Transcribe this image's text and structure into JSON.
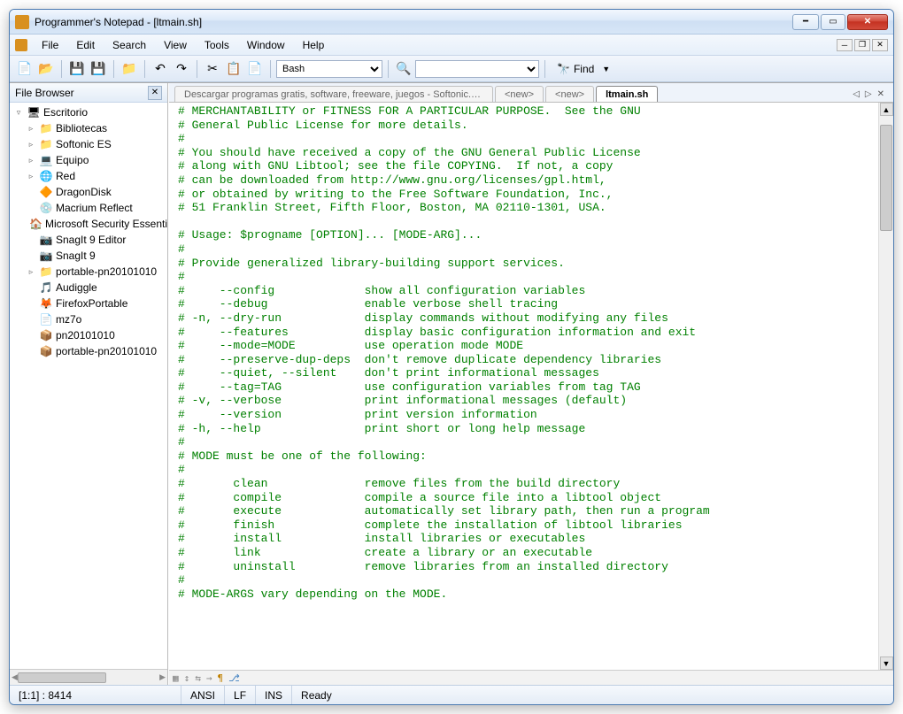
{
  "titlebar": {
    "title": "Programmer's Notepad - [ltmain.sh]"
  },
  "menubar": {
    "items": [
      "File",
      "Edit",
      "Search",
      "View",
      "Tools",
      "Window",
      "Help"
    ]
  },
  "toolbar": {
    "language_select": "Bash",
    "find_label": "Find"
  },
  "sidebar": {
    "title": "File Browser",
    "root": "Escritorio",
    "items": [
      {
        "label": "Bibliotecas",
        "expandable": true,
        "icon": "📁",
        "color": "#d8a038"
      },
      {
        "label": "Softonic ES",
        "expandable": true,
        "icon": "📁"
      },
      {
        "label": "Equipo",
        "expandable": true,
        "icon": "💻"
      },
      {
        "label": "Red",
        "expandable": true,
        "icon": "🌐"
      },
      {
        "label": "DragonDisk",
        "expandable": false,
        "icon": "🔶"
      },
      {
        "label": "Macrium Reflect",
        "expandable": false,
        "icon": "💿"
      },
      {
        "label": "Microsoft Security Essenti",
        "expandable": false,
        "icon": "🏠"
      },
      {
        "label": "SnagIt 9 Editor",
        "expandable": false,
        "icon": "📷"
      },
      {
        "label": "SnagIt 9",
        "expandable": false,
        "icon": "📷"
      },
      {
        "label": "portable-pn20101010",
        "expandable": true,
        "icon": "📁"
      },
      {
        "label": "Audiggle",
        "expandable": false,
        "icon": "🎵"
      },
      {
        "label": "FirefoxPortable",
        "expandable": false,
        "icon": "🦊"
      },
      {
        "label": "mz7o",
        "expandable": false,
        "icon": "📄"
      },
      {
        "label": "pn20101010",
        "expandable": false,
        "icon": "📦"
      },
      {
        "label": "portable-pn20101010",
        "expandable": false,
        "icon": "📦"
      }
    ]
  },
  "tabs": {
    "items": [
      {
        "label": "Descargar programas gratis, software, freeware, juegos - Softonic.htm",
        "active": false
      },
      {
        "label": "<new>",
        "active": false
      },
      {
        "label": "<new>",
        "active": false
      },
      {
        "label": "ltmain.sh",
        "active": true
      }
    ]
  },
  "code": {
    "lines": [
      "# MERCHANTABILITY or FITNESS FOR A PARTICULAR PURPOSE.  See the GNU",
      "# General Public License for more details.",
      "#",
      "# You should have received a copy of the GNU General Public License",
      "# along with GNU Libtool; see the file COPYING.  If not, a copy",
      "# can be downloaded from http://www.gnu.org/licenses/gpl.html,",
      "# or obtained by writing to the Free Software Foundation, Inc.,",
      "# 51 Franklin Street, Fifth Floor, Boston, MA 02110-1301, USA.",
      "",
      "# Usage: $progname [OPTION]... [MODE-ARG]...",
      "#",
      "# Provide generalized library-building support services.",
      "#",
      "#     --config             show all configuration variables",
      "#     --debug              enable verbose shell tracing",
      "# -n, --dry-run            display commands without modifying any files",
      "#     --features           display basic configuration information and exit",
      "#     --mode=MODE          use operation mode MODE",
      "#     --preserve-dup-deps  don't remove duplicate dependency libraries",
      "#     --quiet, --silent    don't print informational messages",
      "#     --tag=TAG            use configuration variables from tag TAG",
      "# -v, --verbose            print informational messages (default)",
      "#     --version            print version information",
      "# -h, --help               print short or long help message",
      "#",
      "# MODE must be one of the following:",
      "#",
      "#       clean              remove files from the build directory",
      "#       compile            compile a source file into a libtool object",
      "#       execute            automatically set library path, then run a program",
      "#       finish             complete the installation of libtool libraries",
      "#       install            install libraries or executables",
      "#       link               create a library or an executable",
      "#       uninstall          remove libraries from an installed directory",
      "#",
      "# MODE-ARGS vary depending on the MODE."
    ]
  },
  "statusbar": {
    "pos": "[1:1] : 8414",
    "encoding": "ANSI",
    "line_ending": "LF",
    "mode": "INS",
    "status": "Ready"
  }
}
